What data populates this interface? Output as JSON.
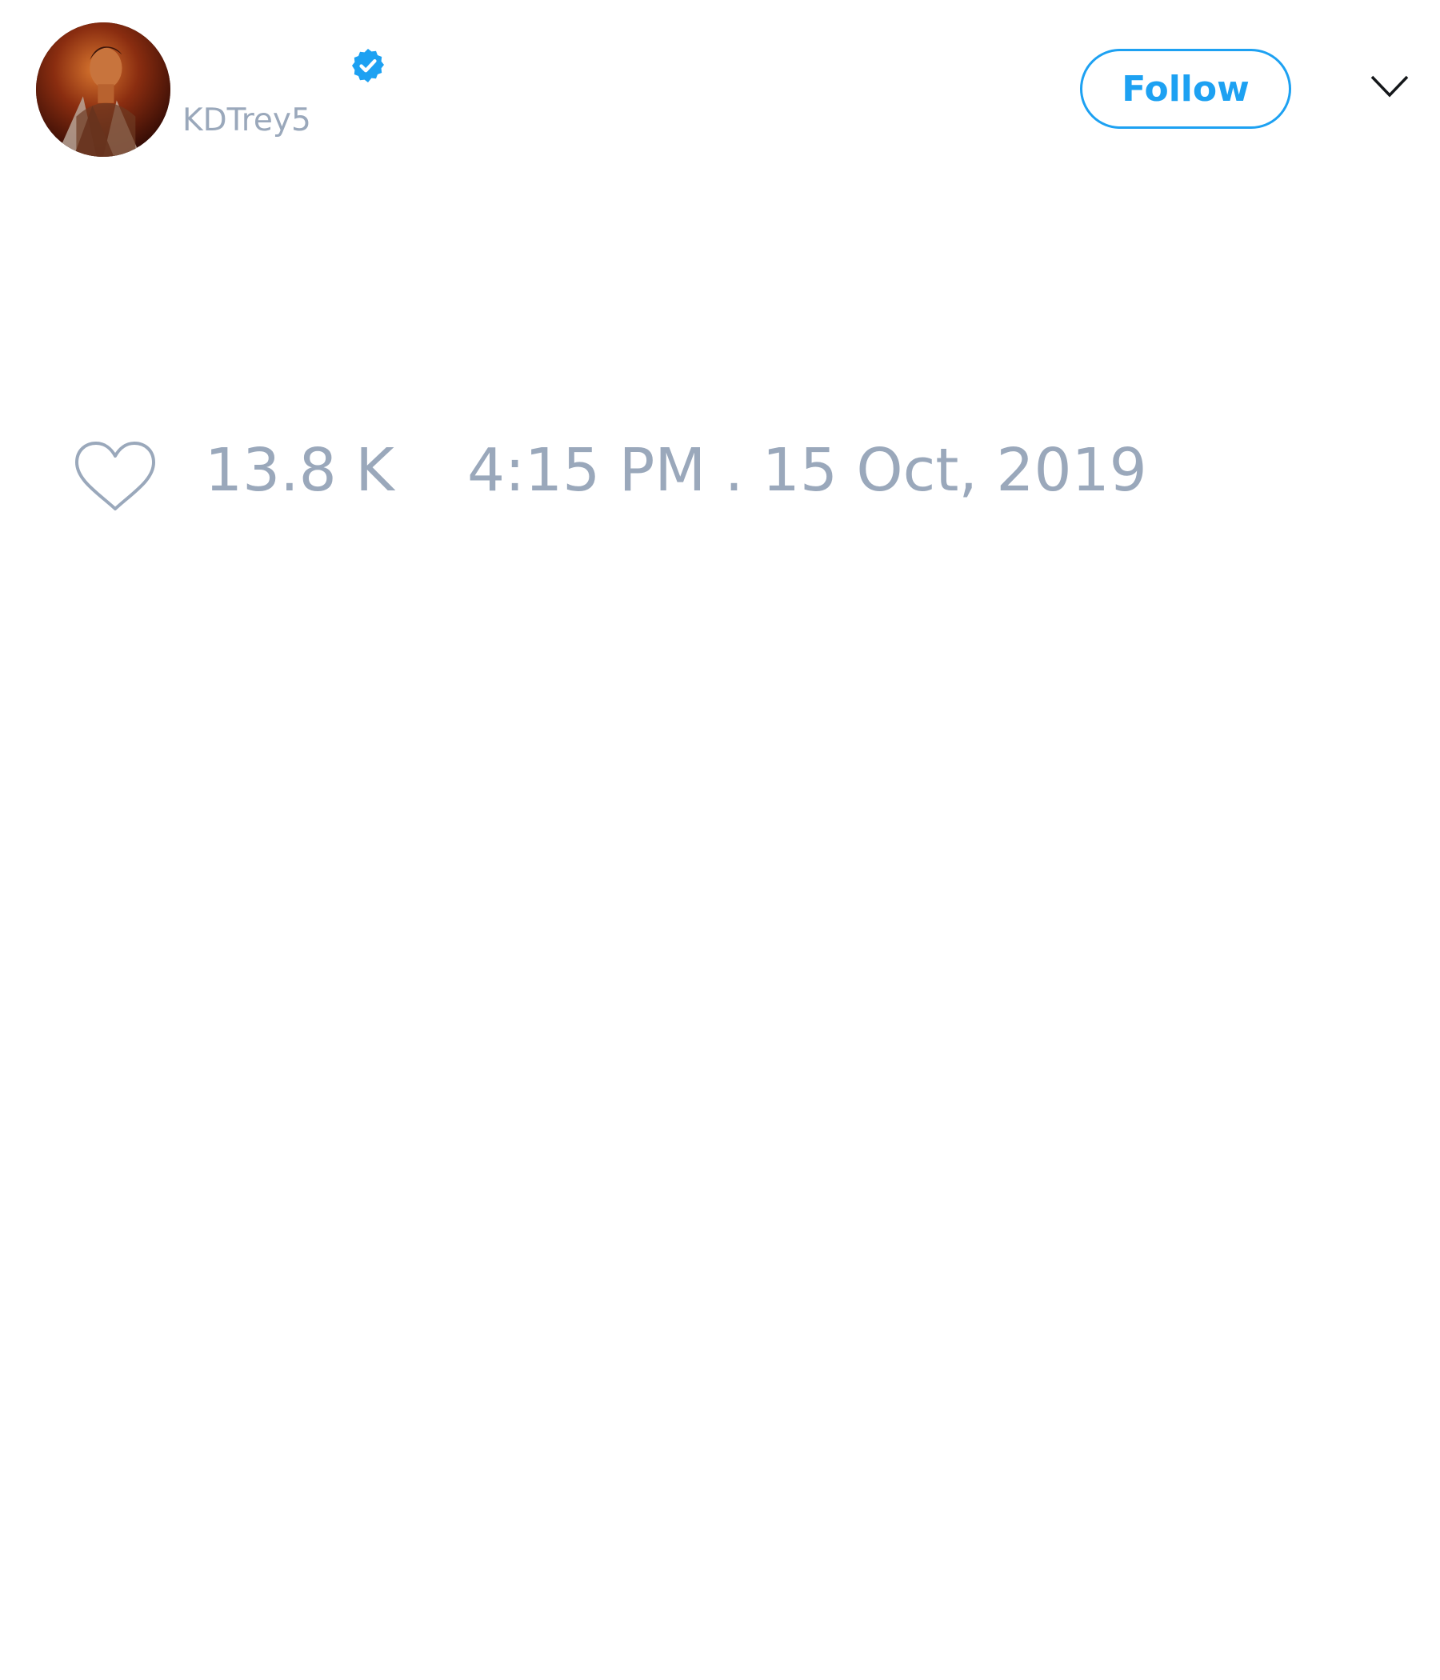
{
  "author": {
    "display_name": "",
    "handle": "KDTrey5",
    "verified": true,
    "avatar_icon": "avatar-photo"
  },
  "header": {
    "follow_label": "Follow",
    "menu_icon": "chevron-down-icon"
  },
  "stats": {
    "like_icon": "heart-outline-icon",
    "like_count": "13.8 K",
    "timestamp": "4:15 PM . 15 Oct, 2019"
  },
  "colors": {
    "accent": "#1da1f2",
    "muted_text": "#9aa8bb",
    "background": "#ffffff"
  }
}
